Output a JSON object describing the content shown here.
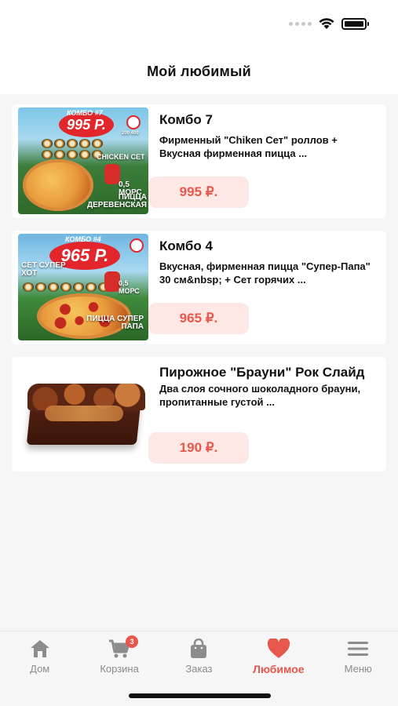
{
  "header": {
    "title": "Мой любимый"
  },
  "items": [
    {
      "title": "Комбо 7",
      "description": "Фирменный \"Chiken Сет\" роллов + Вкусная фирменная пицца ...",
      "price": "995 ₽.",
      "image_text": {
        "header": "КОМБО #7",
        "price": "995 Р.",
        "set": "CHICKEN СЕТ",
        "drink": "0,5 МОРС",
        "pizza": "ПИЦЦА ДЕРЕВЕНСКАЯ",
        "weight": "200 400"
      }
    },
    {
      "title": "Комбо 4",
      "description": "Вкусная, фирменная пицца \"Супер-Папа\" 30 см&nbsp; + Сет горячих ...",
      "price": "965 ₽.",
      "image_text": {
        "header": "КОМБО #4",
        "price": "965 Р.",
        "set": "СЕТ СУПЕР ХОТ",
        "drink": "0,5 МОРС",
        "pizza": "ПИЦЦА СУПЕР ПАПА"
      }
    },
    {
      "title": "Пирожное \"Брауни\" Рок Слайд",
      "description": "Два слоя сочного шоколадного брауни, пропитанные густой ...",
      "price": "190 ₽."
    }
  ],
  "tabbar": {
    "items": [
      {
        "label": "Дом",
        "icon": "home-icon"
      },
      {
        "label": "Корзина",
        "icon": "cart-icon",
        "badge": "3"
      },
      {
        "label": "Заказ",
        "icon": "bag-icon"
      },
      {
        "label": "Любимое",
        "icon": "heart-icon",
        "active": true
      },
      {
        "label": "Меню",
        "icon": "menu-icon"
      }
    ]
  },
  "colors": {
    "accent": "#e7574b",
    "price_bg": "#fde8e6",
    "inactive": "#8c8c8c"
  }
}
